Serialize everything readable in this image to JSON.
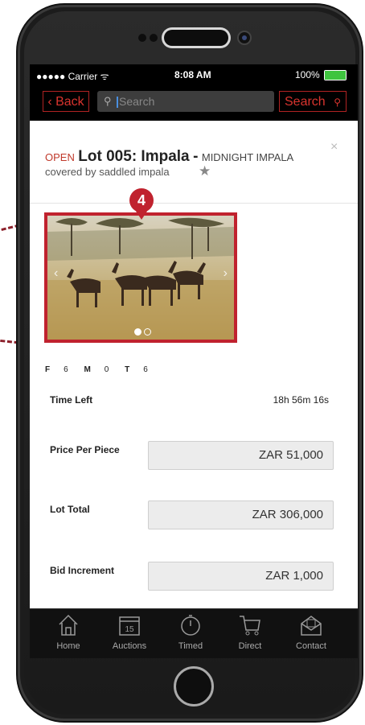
{
  "statusbar": {
    "carrier": "●●●●● Carrier ᯤ",
    "time": "8:08 AM",
    "battery": "100%"
  },
  "nav": {
    "back_label": "Back",
    "search_placeholder": "Search",
    "search_button_label": "Search"
  },
  "lot": {
    "status": "OPEN",
    "title": "Lot 005: Impala",
    "dash": "-",
    "subtitle": "MIDNIGHT IMPALA",
    "covered_by": "covered by saddled impala",
    "close": "×"
  },
  "marker_number": "4",
  "counts": [
    {
      "key": "F",
      "value": "6"
    },
    {
      "key": "M",
      "value": "0"
    },
    {
      "key": "T",
      "value": "6"
    }
  ],
  "details": {
    "time_left_label": "Time Left",
    "time_left_value": "18h 56m 16s",
    "price_per_piece_label": "Price Per Piece",
    "price_per_piece_value": "ZAR 51,000",
    "lot_total_label": "Lot Total",
    "lot_total_value": "ZAR 306,000",
    "bid_increment_label": "Bid Increment",
    "bid_increment_value": "ZAR 1,000"
  },
  "tabs": [
    {
      "label": "Home",
      "icon": "home-icon"
    },
    {
      "label": "Auctions",
      "icon": "calendar-icon",
      "badge": "15"
    },
    {
      "label": "Timed",
      "icon": "stopwatch-icon"
    },
    {
      "label": "Direct",
      "icon": "cart-icon"
    },
    {
      "label": "Contact",
      "icon": "envelope-icon"
    }
  ],
  "colors": {
    "accent": "#c0222e",
    "battery": "#3ec43e"
  }
}
